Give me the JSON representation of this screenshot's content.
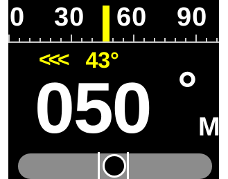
{
  "compass": {
    "tape_labels": [
      "0",
      "30",
      "60",
      "90"
    ],
    "bearing_arrows": "<<<",
    "bearing_value": "43°",
    "heading_value": "050",
    "heading_degree_symbol": "°",
    "heading_reference": "M"
  },
  "colors": {
    "background": "#000000",
    "accent": "#ffff00",
    "text": "#ffffff",
    "level_bar": "#8c8c8c",
    "tick": "#c8c8c8"
  },
  "icons": {
    "level_bubble": "bubble-level-icon"
  }
}
